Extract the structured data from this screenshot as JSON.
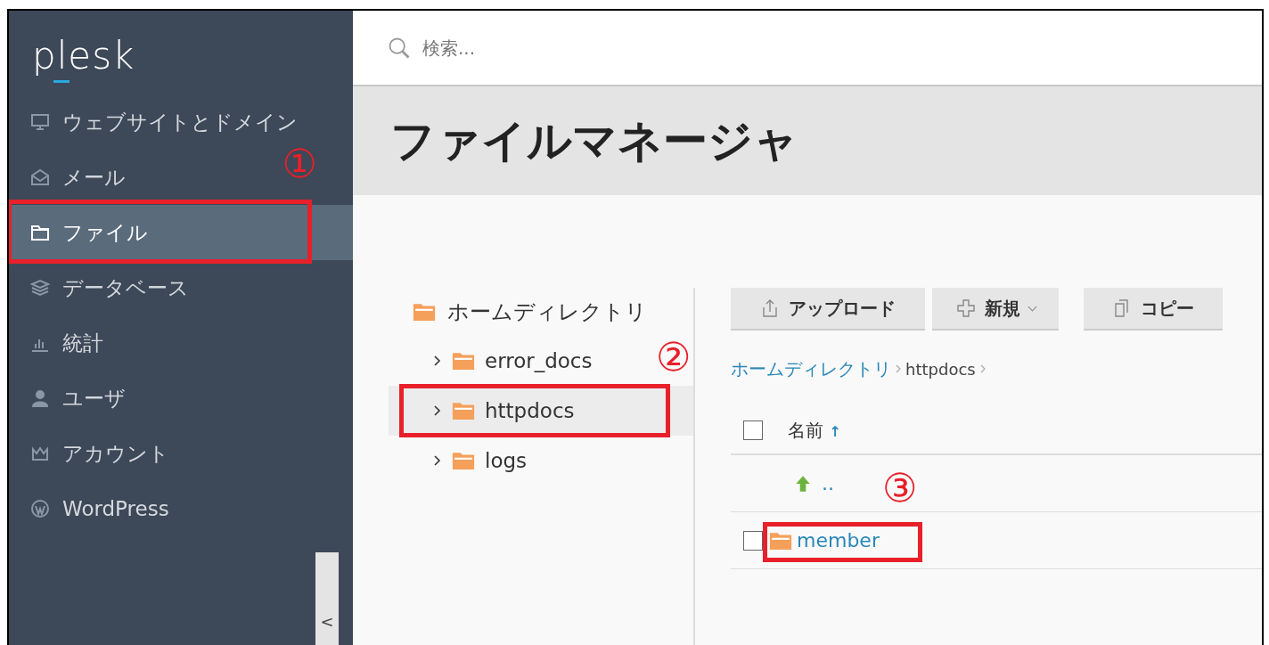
{
  "sidebar": {
    "logo": "plesk",
    "items": [
      {
        "label": "ウェブサイトとドメイン",
        "selected": false,
        "highlighted": false
      },
      {
        "label": "メール",
        "selected": false,
        "highlighted": false
      },
      {
        "label": "ファイル",
        "selected": true,
        "highlighted": true,
        "callout": "①"
      },
      {
        "label": "データベース",
        "selected": false,
        "highlighted": false
      },
      {
        "label": "統計",
        "selected": false,
        "highlighted": false
      },
      {
        "label": "ユーザ",
        "selected": false,
        "highlighted": false
      },
      {
        "label": "アカウント",
        "selected": false,
        "highlighted": false
      },
      {
        "label": "WordPress",
        "selected": false,
        "highlighted": false
      }
    ],
    "toggle": "<"
  },
  "search": {
    "placeholder": "検索..."
  },
  "page_title": "ファイルマネージャ",
  "tree": {
    "label": "ホームディレクトリ",
    "children": [
      {
        "label": "error_docs",
        "selected": false,
        "highlighted": false
      },
      {
        "label": "httpdocs",
        "selected": true,
        "highlighted": true,
        "callout": "②"
      },
      {
        "label": "logs",
        "selected": false,
        "highlighted": false
      }
    ]
  },
  "toolbar": [
    {
      "label": "アップロード",
      "dropdown": false
    },
    {
      "label": "新規",
      "dropdown": true
    },
    {
      "label": "コピー",
      "dropdown": false
    }
  ],
  "breadcrumb": [
    {
      "label": "ホームディレクトリ",
      "link": true
    },
    {
      "label": "httpdocs",
      "link": false
    }
  ],
  "table": {
    "select_all": {
      "checked": false
    },
    "columns": [
      {
        "label": "名前",
        "sort": "↑"
      }
    ],
    "rows": [
      {
        "kind": "parent",
        "name": ".."
      },
      {
        "kind": "folder",
        "name": "member",
        "checked": false,
        "highlighted": true,
        "callout": "③"
      }
    ]
  }
}
